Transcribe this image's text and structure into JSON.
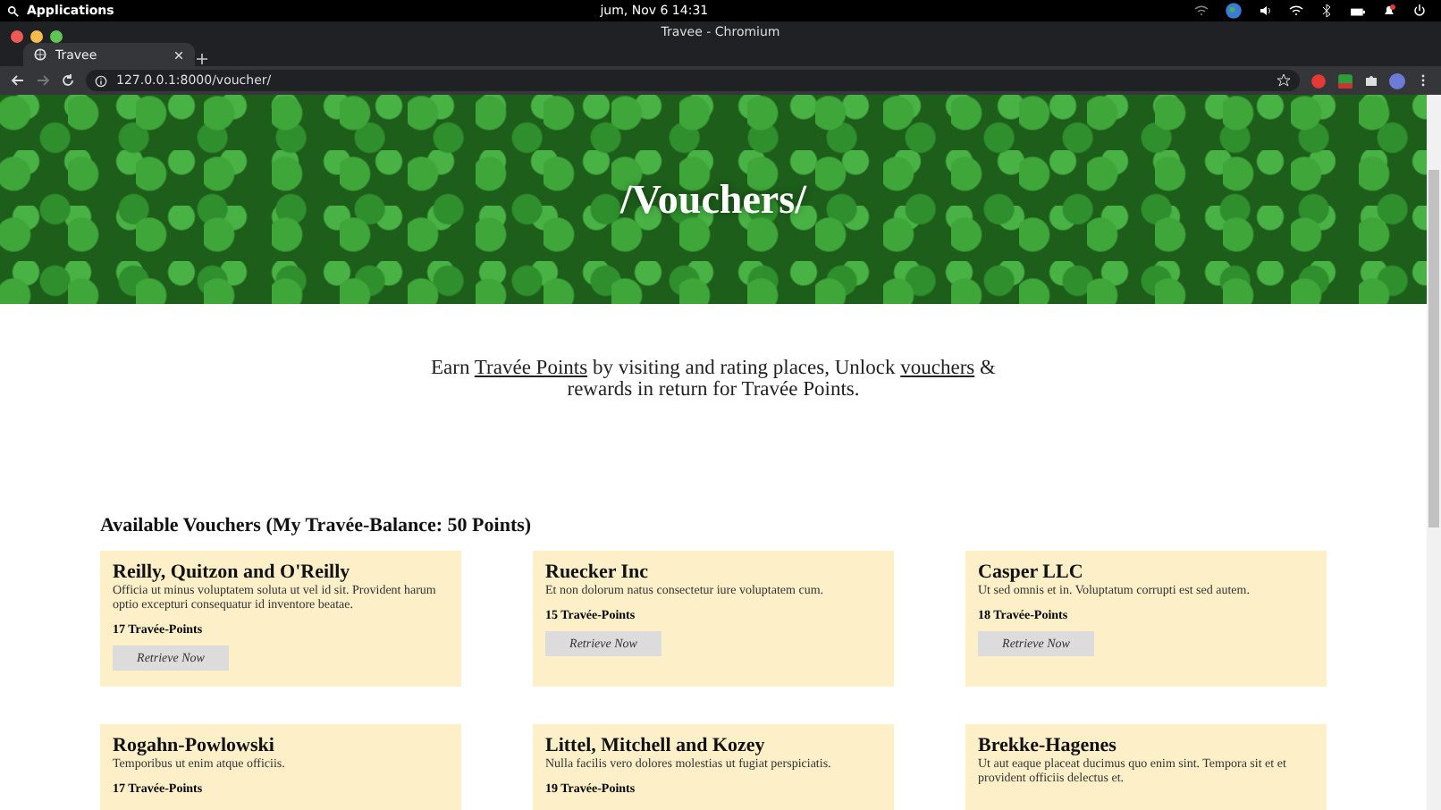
{
  "system_bar": {
    "launcher": "Applications",
    "clock": "jum, Nov  6   14:31"
  },
  "window": {
    "title": "Travee - Chromium"
  },
  "tabs": [
    {
      "label": "Travee",
      "selected": true
    }
  ],
  "address_bar": {
    "url": "127.0.0.1:8000/voucher/"
  },
  "hero": {
    "title": "/Vouchers/"
  },
  "intro": {
    "parts": [
      {
        "kind": "text",
        "text": "Earn "
      },
      {
        "kind": "link",
        "text": "Travée Points"
      },
      {
        "kind": "text",
        "text": " by visiting and rating places, Unlock "
      },
      {
        "kind": "link",
        "text": "vouchers"
      },
      {
        "kind": "text",
        "text": " & rewards in return for Travée Points."
      }
    ]
  },
  "section": {
    "heading": "Available Vouchers (My Travée-Balance: 50 Points)"
  },
  "vouchers": [
    {
      "name": "Reilly, Quitzon and O'Reilly",
      "description": "Officia ut minus voluptatem soluta ut vel id sit. Provident harum optio excepturi consequatur id inventore beatae.",
      "points": "17 Travée-Points",
      "button": "Retrieve Now"
    },
    {
      "name": "Ruecker Inc",
      "description": "Et non dolorum natus consectetur iure voluptatem cum.",
      "points": "15 Travée-Points",
      "button": "Retrieve Now"
    },
    {
      "name": "Casper LLC",
      "description": "Ut sed omnis et in. Voluptatum corrupti est sed autem.",
      "points": "18 Travée-Points",
      "button": "Retrieve Now"
    },
    {
      "name": "Rogahn-Powlowski",
      "description": "Temporibus ut enim atque officiis.",
      "points": "17 Travée-Points"
    },
    {
      "name": "Littel, Mitchell and Kozey",
      "description": "Nulla facilis vero dolores molestias ut fugiat perspiciatis.",
      "points": "19 Travée-Points"
    },
    {
      "name": "Brekke-Hagenes",
      "description": "Ut aut eaque placeat ducimus quo enim sint. Tempora sit et et provident officiis delectus et."
    }
  ]
}
